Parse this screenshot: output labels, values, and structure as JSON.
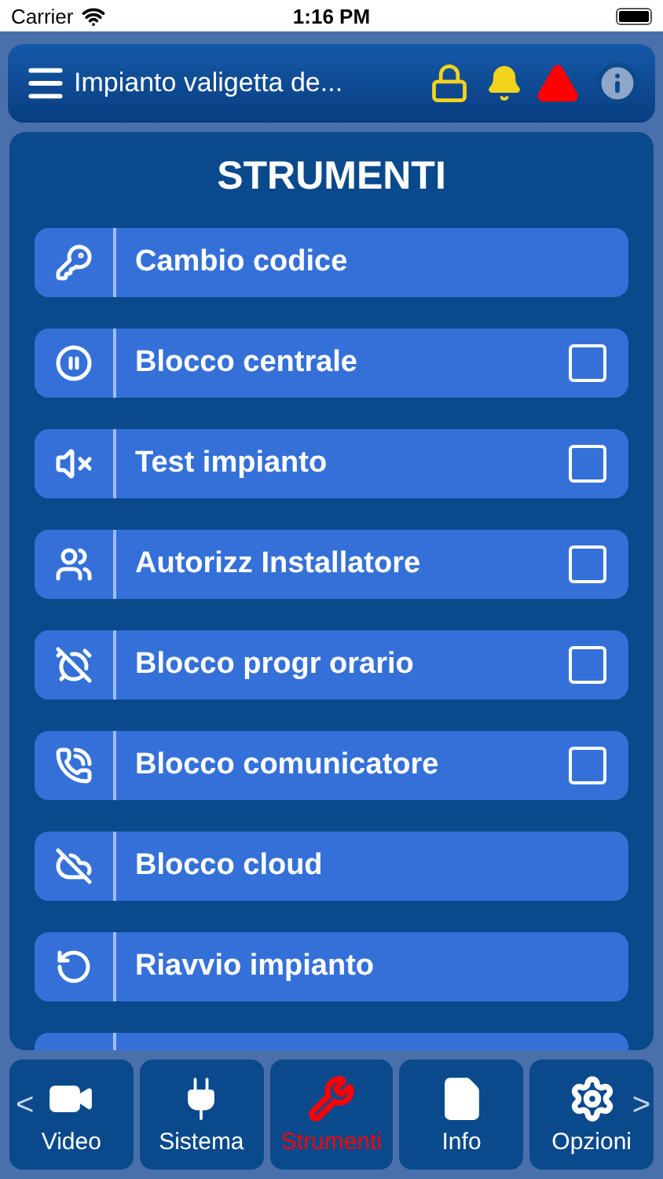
{
  "status_bar": {
    "carrier": "Carrier",
    "time": "1:16 PM"
  },
  "header": {
    "title": "Impianto valigetta de..."
  },
  "panel": {
    "title": "STRUMENTI",
    "items": [
      {
        "kind": "action",
        "label": "Cambio codice"
      },
      {
        "kind": "toggle",
        "label": "Blocco centrale",
        "checked": false
      },
      {
        "kind": "toggle",
        "label": "Test impianto",
        "checked": false
      },
      {
        "kind": "toggle",
        "label": "Autorizz Installatore",
        "checked": false
      },
      {
        "kind": "toggle",
        "label": "Blocco progr orario",
        "checked": false
      },
      {
        "kind": "toggle",
        "label": "Blocco comunicatore",
        "checked": false
      },
      {
        "kind": "action",
        "label": "Blocco cloud"
      },
      {
        "kind": "action",
        "label": "Riavvio impianto"
      },
      {
        "kind": "partial"
      }
    ]
  },
  "tab_bar": {
    "prev": "<",
    "next": ">",
    "tabs": [
      {
        "label": "Video",
        "selected": false
      },
      {
        "label": "Sistema",
        "selected": false
      },
      {
        "label": "Strumenti",
        "selected": true
      },
      {
        "label": "Info",
        "selected": false
      },
      {
        "label": "Opzioni",
        "selected": false
      }
    ]
  }
}
